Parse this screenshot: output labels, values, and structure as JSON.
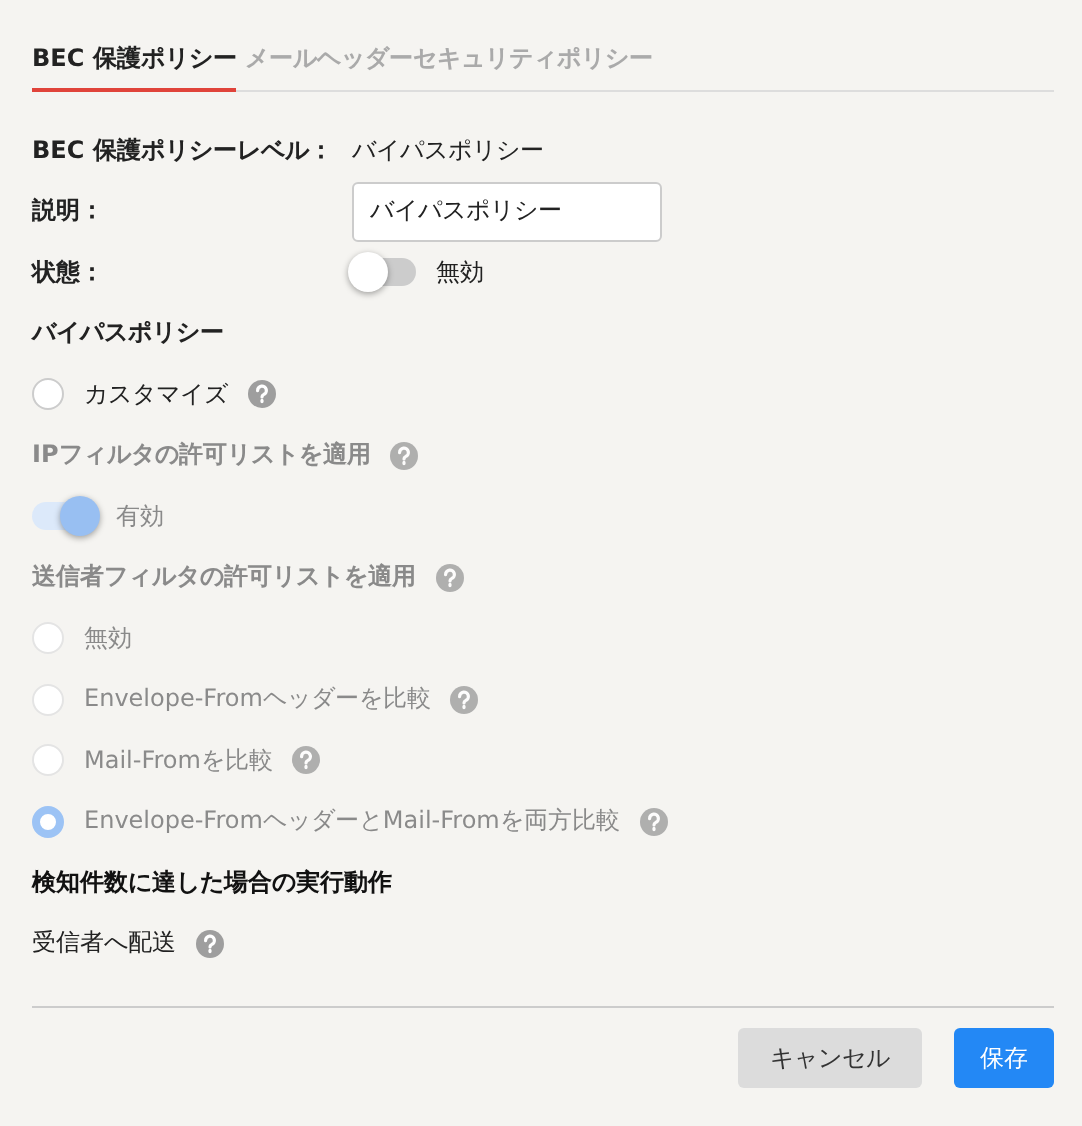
{
  "tabs": [
    {
      "label": "BEC 保護ポリシー",
      "selected": true
    },
    {
      "label": "メールヘッダーセキュリティポリシー",
      "selected": false
    }
  ],
  "level": {
    "label": "BEC 保護ポリシーレベル：",
    "value": "バイパスポリシー"
  },
  "description": {
    "label": "説明：",
    "value": "バイパスポリシー"
  },
  "status": {
    "label": "状態：",
    "on": false,
    "text": "無効"
  },
  "bypass": {
    "title": "バイパスポリシー",
    "options": [
      {
        "label": "カスタマイズ",
        "selected": false,
        "help": true
      }
    ]
  },
  "ip_filter": {
    "title": "IPフィルタの許可リストを適用",
    "help": true,
    "disabled": true,
    "on": true,
    "text": "有効"
  },
  "sender_filter": {
    "title": "送信者フィルタの許可リストを適用",
    "help": true,
    "disabled": true,
    "options": [
      {
        "label": "無効",
        "selected": false,
        "help": false
      },
      {
        "label": "Envelope-Fromヘッダーを比較",
        "selected": false,
        "help": true
      },
      {
        "label": "Mail-Fromを比較",
        "selected": false,
        "help": true
      },
      {
        "label": "Envelope-FromヘッダーとMail-Fromを両方比較",
        "selected": true,
        "help": true
      }
    ]
  },
  "action": {
    "title": "検知件数に達した場合の実行動作",
    "value": "受信者へ配送",
    "help": true
  },
  "buttons": [
    {
      "label": "キャンセル",
      "kind": "secondary"
    },
    {
      "label": "保存",
      "kind": "primary"
    }
  ]
}
